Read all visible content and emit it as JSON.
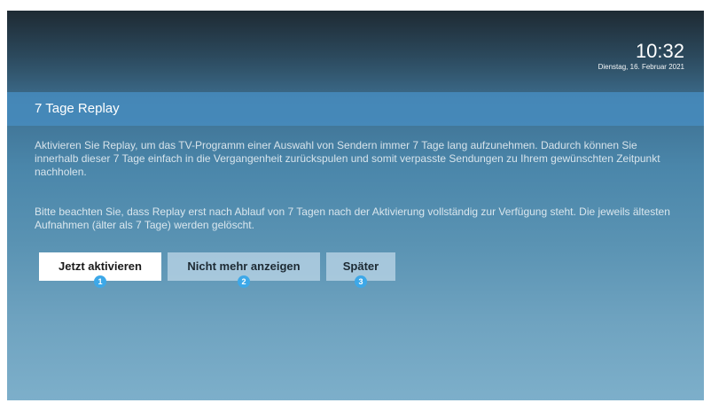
{
  "clock": {
    "time": "10:32",
    "date": "Dienstag, 16. Februar 2021"
  },
  "dialog": {
    "title": "7 Tage Replay",
    "paragraph1": "Aktivieren Sie Replay, um das TV-Programm einer Auswahl von Sendern immer 7 Tage lang aufzunehmen. Dadurch können Sie innerhalb dieser 7 Tage einfach in die Vergangenheit zurückspulen und somit verpasste Sendungen zu Ihrem gewünschten Zeitpunkt nachholen.",
    "paragraph2": "Bitte beachten Sie, dass Replay erst nach Ablauf von 7 Tagen nach der Aktivierung vollständig zur Verfügung steht. Die jeweils ältesten Aufnahmen (älter als 7 Tage) werden gelöscht."
  },
  "buttons": [
    {
      "label": "Jetzt aktivieren",
      "marker": "1"
    },
    {
      "label": "Nicht mehr anzeigen",
      "marker": "2"
    },
    {
      "label": "Später",
      "marker": "3"
    }
  ]
}
